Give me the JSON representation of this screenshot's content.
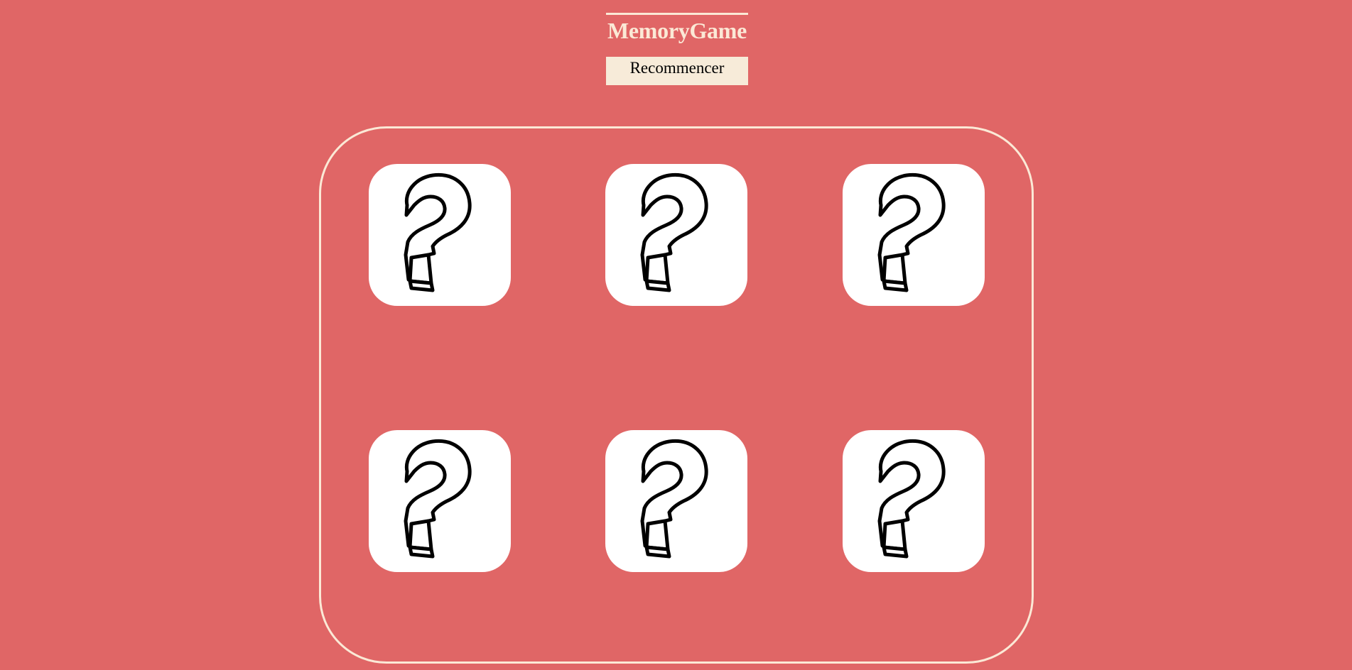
{
  "header": {
    "title": "MemoryGame"
  },
  "controls": {
    "restart_label": "Recommencer"
  },
  "board": {
    "cards": [
      {
        "state": "face-down",
        "icon": "question-mark-icon"
      },
      {
        "state": "face-down",
        "icon": "question-mark-icon"
      },
      {
        "state": "face-down",
        "icon": "question-mark-icon"
      },
      {
        "state": "face-down",
        "icon": "question-mark-icon"
      },
      {
        "state": "face-down",
        "icon": "question-mark-icon"
      },
      {
        "state": "face-down",
        "icon": "question-mark-icon"
      }
    ]
  },
  "colors": {
    "background": "#e06666",
    "accent": "#fbe9d6",
    "button_background": "#f7ebd9",
    "card_background": "#ffffff"
  }
}
